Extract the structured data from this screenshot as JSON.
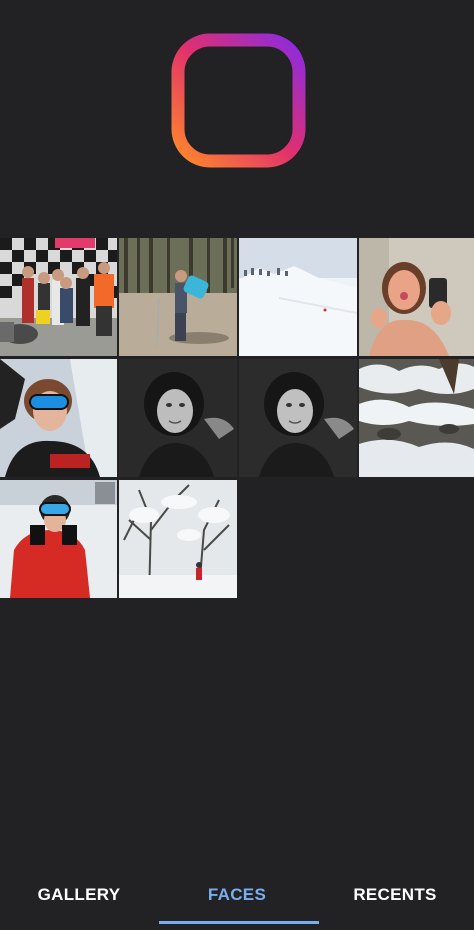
{
  "app": {
    "logo_icon": "layout-app-logo-icon",
    "logo_gradient": [
      "#7b2ff7",
      "#e1306c",
      "#ff9a3c"
    ]
  },
  "photos": [
    {
      "name": "group-photo-checkered-wall"
    },
    {
      "name": "hiker-forest-photo"
    },
    {
      "name": "snowy-mountain-slope-photo"
    },
    {
      "name": "selfie-thumbs-up-photo"
    },
    {
      "name": "selfie-ski-goggles-photo"
    },
    {
      "name": "black-white-portrait-photo-1"
    },
    {
      "name": "black-white-portrait-photo-2"
    },
    {
      "name": "snow-covered-rocks-photo"
    },
    {
      "name": "skier-red-jacket-photo"
    },
    {
      "name": "snowy-forest-skier-photo"
    }
  ],
  "tabs": {
    "gallery": "GALLERY",
    "faces": "FACES",
    "recents": "RECENTS",
    "active": "FACES",
    "accent_color": "#78aef0"
  }
}
